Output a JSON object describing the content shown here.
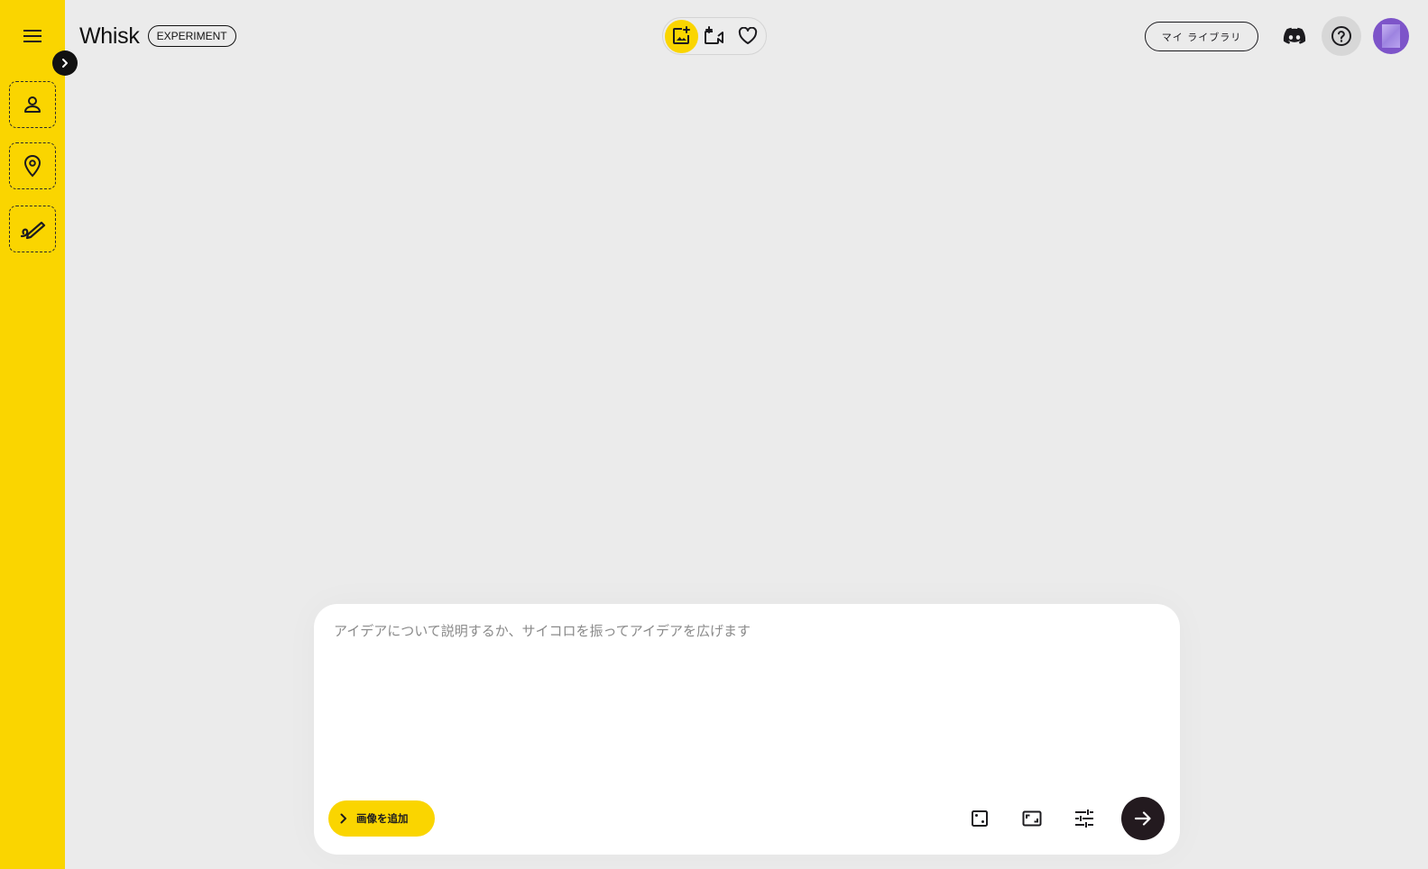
{
  "app": {
    "name": "Whisk",
    "badge": "EXPERIMENT"
  },
  "sidebar": {
    "menu_icon": "menu-icon",
    "expand_icon": "chevron-right-icon",
    "slots": [
      {
        "name": "subject",
        "icon": "person-icon"
      },
      {
        "name": "scene",
        "icon": "location-pin-icon"
      },
      {
        "name": "style",
        "icon": "brush-stroke-icon"
      }
    ],
    "accent": "#fad500"
  },
  "header": {
    "modes": [
      {
        "name": "image",
        "icon": "add-photo-icon",
        "active": true
      },
      {
        "name": "video",
        "icon": "video-sparkle-icon",
        "active": false
      },
      {
        "name": "favorites",
        "icon": "heart-icon",
        "active": false
      }
    ],
    "library_label": "マイ ライブラリ",
    "discord_icon": "discord-icon",
    "help_icon": "help-circle-icon"
  },
  "composer": {
    "placeholder": "アイデアについて説明するか、サイコロを振ってアイデアを広げます",
    "value": "",
    "add_image_label": "画像を追加",
    "tools": [
      "dice-icon",
      "aspect-ratio-icon",
      "tune-icon"
    ],
    "send_icon": "arrow-right-icon",
    "send_color": "#231a1f"
  }
}
